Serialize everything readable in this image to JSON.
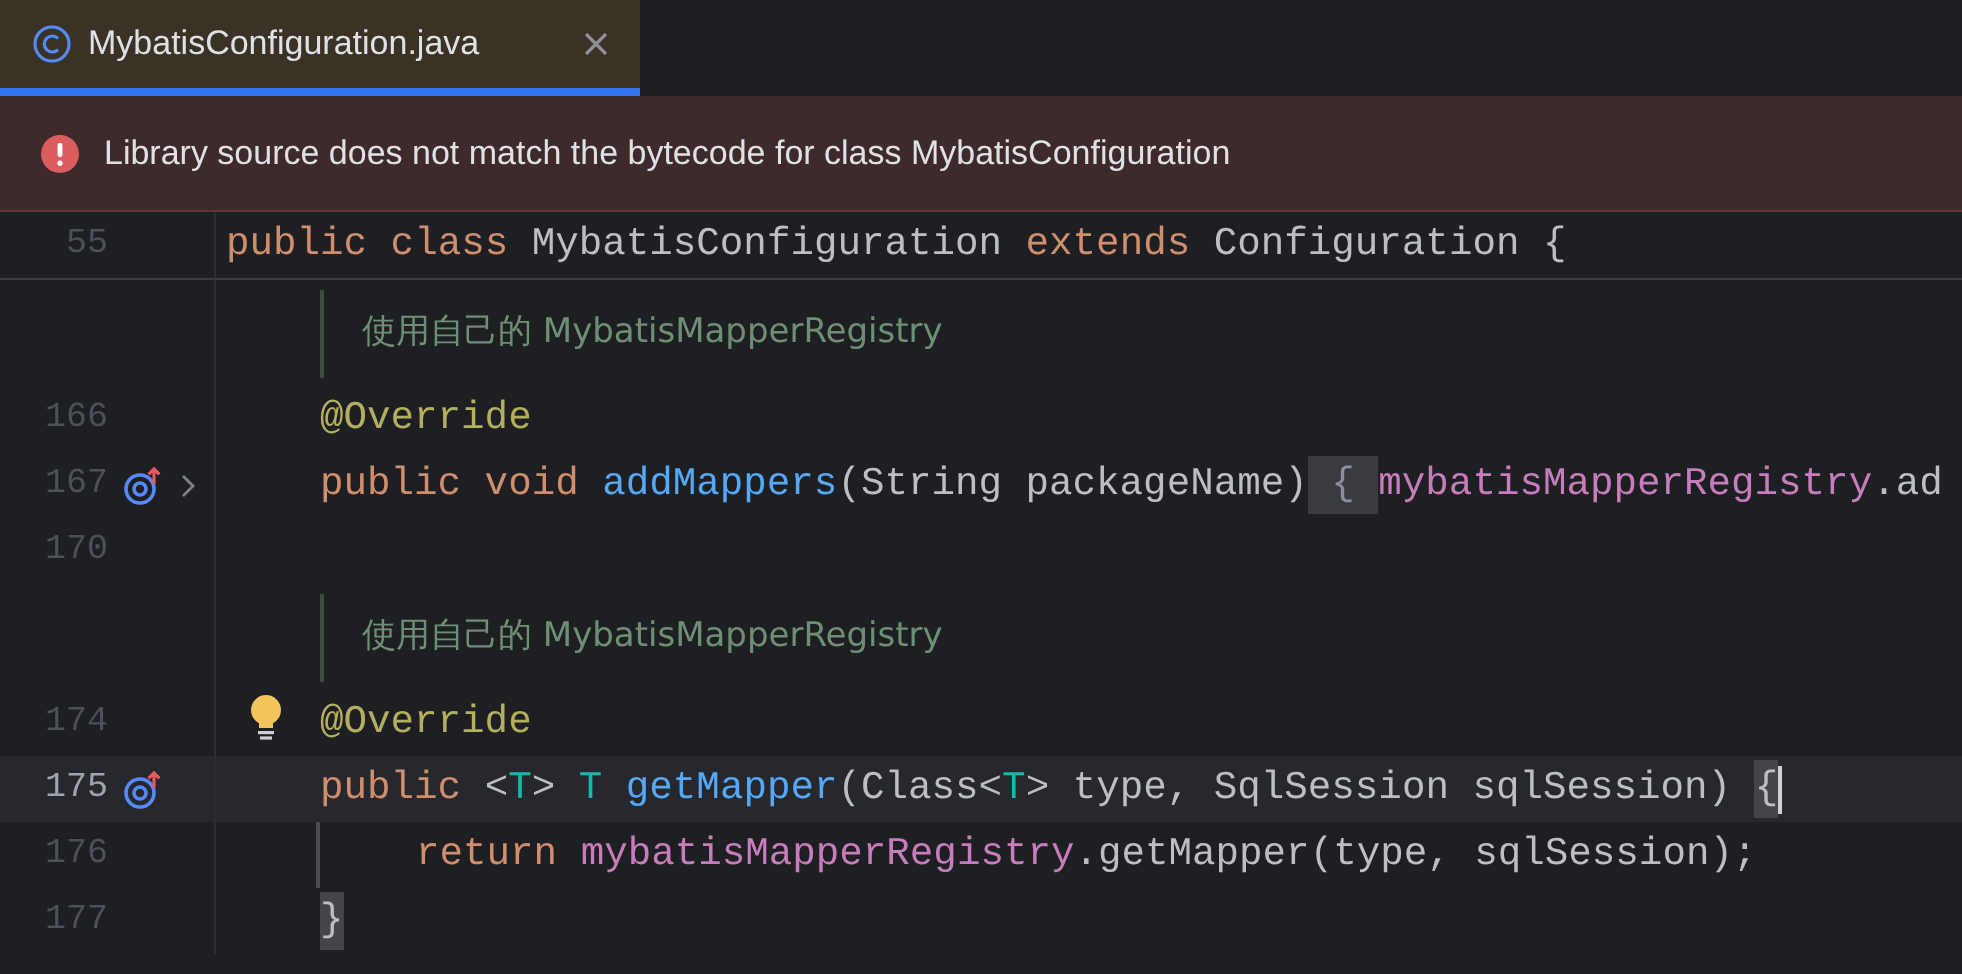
{
  "tabs": [
    {
      "label": "MybatisConfiguration.java",
      "selected": true
    }
  ],
  "banner": {
    "kind": "error",
    "message": "Library source does not match the bytecode for class MybatisConfiguration"
  },
  "sticky_line": {
    "number": "55",
    "tokens": [
      {
        "text": "public class ",
        "kind": "keyword"
      },
      {
        "text": "MybatisConfiguration ",
        "kind": "plain"
      },
      {
        "text": "extends ",
        "kind": "keyword"
      },
      {
        "text": "Configuration {",
        "kind": "plain"
      }
    ]
  },
  "lines": [
    {
      "kind": "doc",
      "text": "使用自己的 MybatisMapperRegistry"
    },
    {
      "kind": "member",
      "number": "166",
      "current": false,
      "tokens": [
        {
          "text": "@Override",
          "kind": "annotation"
        }
      ]
    },
    {
      "kind": "member",
      "number": "167",
      "current": false,
      "icons": [
        {
          "kind": "override"
        },
        {
          "kind": "fold"
        }
      ],
      "tokens": [
        {
          "text": "public void ",
          "kind": "keyword"
        },
        {
          "text": "addMappers",
          "kind": "method"
        },
        {
          "text": "(String packageName)",
          "kind": "plain"
        },
        {
          "text": " { ",
          "kind": "folded"
        },
        {
          "text": "mybatisMapperRegistry",
          "kind": "field"
        },
        {
          "text": ".ad",
          "kind": "plain"
        }
      ]
    },
    {
      "kind": "blank",
      "number": "170",
      "current": false
    },
    {
      "kind": "doc",
      "text": "使用自己的 MybatisMapperRegistry"
    },
    {
      "kind": "member",
      "number": "174",
      "current": false,
      "icons": [
        {
          "kind": "bulb"
        }
      ],
      "tokens": [
        {
          "text": "@Override",
          "kind": "annotation"
        }
      ]
    },
    {
      "kind": "member",
      "number": "175",
      "current": true,
      "icons": [
        {
          "kind": "override"
        }
      ],
      "tokens": [
        {
          "text": "public ",
          "kind": "keyword"
        },
        {
          "text": "<",
          "kind": "plain"
        },
        {
          "text": "T",
          "kind": "typeparam"
        },
        {
          "text": "> ",
          "kind": "plain"
        },
        {
          "text": "T ",
          "kind": "typeparam"
        },
        {
          "text": "getMapper",
          "kind": "method"
        },
        {
          "text": "(Class<",
          "kind": "plain"
        },
        {
          "text": "T",
          "kind": "typeparam"
        },
        {
          "text": "> type, SqlSession sqlSession) ",
          "kind": "plain"
        },
        {
          "text": "{",
          "kind": "match"
        }
      ]
    },
    {
      "kind": "body",
      "number": "176",
      "current": false,
      "guide": true,
      "tokens": [
        {
          "text": "return ",
          "kind": "keyword"
        },
        {
          "text": "mybatisMapperRegistry",
          "kind": "field"
        },
        {
          "text": ".getMapper(type, sqlSession);",
          "kind": "plain"
        }
      ]
    },
    {
      "kind": "member",
      "number": "177",
      "current": false,
      "tokens": [
        {
          "text": "}",
          "kind": "match"
        }
      ]
    }
  ]
}
